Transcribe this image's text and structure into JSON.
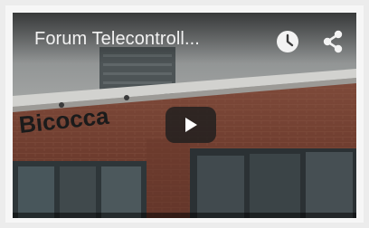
{
  "player": {
    "title": "Forum Telecontroll...",
    "building_sign": "Bicocca",
    "icons": {
      "watch_later": "clock-icon",
      "share": "share-icon",
      "play": "play-icon"
    }
  }
}
